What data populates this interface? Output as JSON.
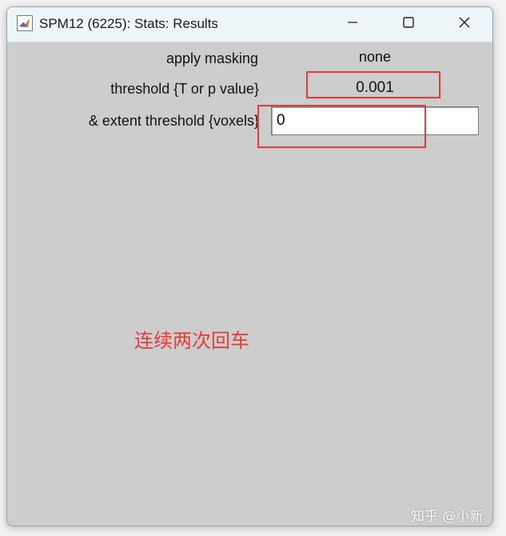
{
  "window": {
    "title": "SPM12 (6225): Stats: Results",
    "icon": "matlab-icon",
    "controls": {
      "minimize": "minimize-icon",
      "maximize": "maximize-icon",
      "close": "close-icon"
    }
  },
  "form": {
    "masking_label": "apply masking",
    "masking_value": "none",
    "threshold_label": "threshold {T or p value}",
    "threshold_value": "0.001",
    "extent_label": "& extent threshold {voxels}",
    "extent_value": "0"
  },
  "annotation": {
    "text": "连续两次回车",
    "color": "#e63b3b"
  },
  "watermark": {
    "text": "知乎 @小新"
  },
  "colors": {
    "window_bg": "#cdcdcd",
    "titlebar_bg": "#eef5f9",
    "highlight": "#e63b3b"
  }
}
